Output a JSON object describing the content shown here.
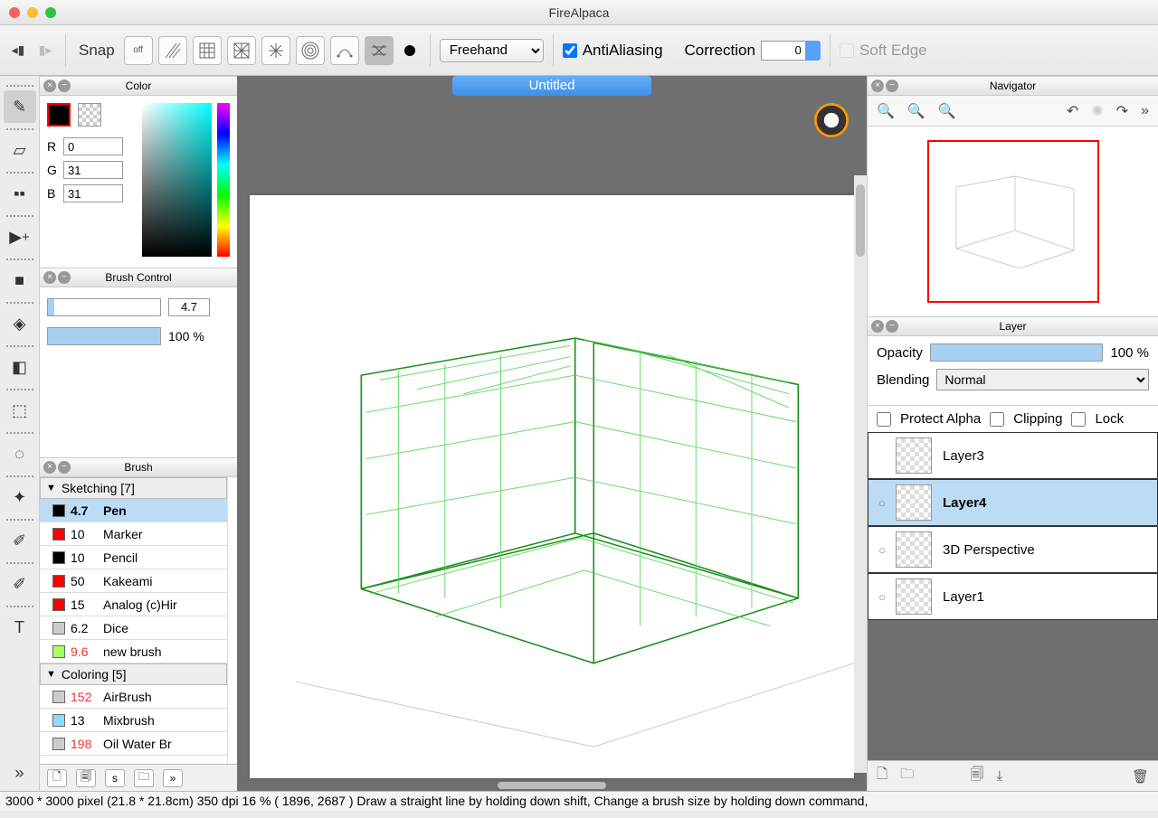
{
  "app_title": "FireAlpaca",
  "traffic_colors": [
    "#ff5f57",
    "#febc2e",
    "#28c840"
  ],
  "toolbar": {
    "snap_label": "Snap",
    "snap_off": "off",
    "mode_select": "Freehand",
    "antialiasing_label": "AntiAliasing",
    "antialiasing_checked": true,
    "correction_label": "Correction",
    "correction_value": "0",
    "softedge_label": "Soft Edge"
  },
  "doc_tab": "Untitled",
  "color_panel": {
    "title": "Color",
    "r": "0",
    "g": "31",
    "b": "31"
  },
  "brush_control": {
    "title": "Brush Control",
    "size": "4.7",
    "opacity": "100 %"
  },
  "brush_panel": {
    "title": "Brush",
    "groups": [
      {
        "name": "Sketching [7]",
        "items": [
          {
            "color": "#000",
            "size": "4.7",
            "name": "Pen",
            "sel": true
          },
          {
            "color": "#f00",
            "size": "10",
            "name": "Marker"
          },
          {
            "color": "#000",
            "size": "10",
            "name": "Pencil"
          },
          {
            "color": "#f00",
            "size": "50",
            "name": "Kakeami"
          },
          {
            "color": "#f00",
            "size": "15",
            "name": "Analog (c)Hir"
          },
          {
            "color": "#ccc",
            "size": "6.2",
            "name": "Dice"
          },
          {
            "color": "#af6",
            "size": "9.6",
            "name": "new brush",
            "red": true
          }
        ]
      },
      {
        "name": "Coloring [5]",
        "items": [
          {
            "color": "#ccc",
            "size": "152",
            "name": "AirBrush",
            "red": true
          },
          {
            "color": "#8df",
            "size": "13",
            "name": "Mixbrush"
          },
          {
            "color": "#ccc",
            "size": "198",
            "name": "Oil Water Br",
            "red": true
          }
        ]
      }
    ]
  },
  "navigator": {
    "title": "Navigator"
  },
  "layer_panel": {
    "title": "Layer",
    "opacity_label": "Opacity",
    "opacity_value": "100 %",
    "blending_label": "Blending",
    "blending_value": "Normal",
    "protect_alpha": "Protect Alpha",
    "clipping": "Clipping",
    "lock": "Lock",
    "layers": [
      {
        "name": "Layer3",
        "vis": ""
      },
      {
        "name": "Layer4",
        "vis": "○",
        "sel": true
      },
      {
        "name": "3D Perspective",
        "vis": "○"
      },
      {
        "name": "Layer1",
        "vis": "○"
      }
    ]
  },
  "statusbar": "3000 * 3000 pixel   (21.8 * 21.8cm)   350 dpi   16 %   ( 1896, 2687 )   Draw a straight line by holding down shift, Change a brush size by holding down command,"
}
